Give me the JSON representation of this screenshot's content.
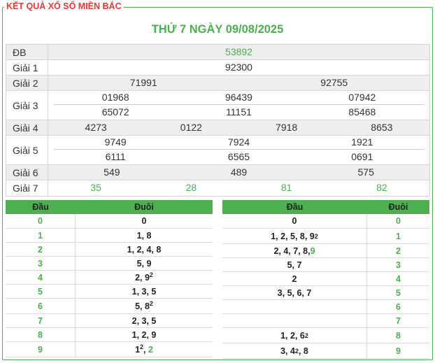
{
  "header": {
    "legend": "KẾT QUẢ XỔ SỐ MIỀN BẮC",
    "date_title": "THỨ 7 NGÀY 09/08/2025"
  },
  "results": {
    "db": {
      "label": "ĐB",
      "values": [
        "53892"
      ]
    },
    "g1": {
      "label": "Giải 1",
      "values": [
        "92300"
      ]
    },
    "g2": {
      "label": "Giải 2",
      "values": [
        "71991",
        "92755"
      ]
    },
    "g3": {
      "label": "Giải 3",
      "values": [
        "01968",
        "96439",
        "07942",
        "65072",
        "11151",
        "85468"
      ]
    },
    "g4": {
      "label": "Giải 4",
      "values": [
        "4273",
        "0122",
        "7918",
        "8653"
      ]
    },
    "g5": {
      "label": "Giải 5",
      "values": [
        "9749",
        "7924",
        "1921",
        "6111",
        "6565",
        "0691"
      ]
    },
    "g6": {
      "label": "Giải 6",
      "values": [
        "549",
        "489",
        "575"
      ]
    },
    "g7": {
      "label": "Giải 7",
      "values": [
        "35",
        "28",
        "81",
        "82"
      ]
    }
  },
  "dau_table": {
    "col_dau": "Đầu",
    "col_duoi": "Đuôi",
    "rows": [
      {
        "dau": "0",
        "duoi": "0"
      },
      {
        "dau": "1",
        "duoi": "1, 8"
      },
      {
        "dau": "2",
        "duoi": "1, 2, 4, 8"
      },
      {
        "dau": "3",
        "duoi": "5, 9"
      },
      {
        "dau": "4",
        "duoi": "2, 9",
        "sup": "2"
      },
      {
        "dau": "5",
        "duoi": "1, 3, 5"
      },
      {
        "dau": "6",
        "duoi": "5, 8",
        "sup": "2"
      },
      {
        "dau": "7",
        "duoi": "2, 3, 5"
      },
      {
        "dau": "8",
        "duoi": "1, 2, 9"
      },
      {
        "dau": "9",
        "duoi_pre": "1",
        "sup": "2",
        "duoi_post": ", ",
        "duoi_green": "2"
      }
    ]
  },
  "duoi_table": {
    "col_dau": "Đầu",
    "col_duoi": "Đuôi",
    "rows": [
      {
        "dau": "0",
        "duoi": "0"
      },
      {
        "dau": "1, 2, 5, 8, 9",
        "sup": "2",
        "duoi": "1"
      },
      {
        "dau_pre": "2, 4, 7, 8, ",
        "dau_green": "9",
        "duoi": "2"
      },
      {
        "dau": "5, 7",
        "duoi": "3"
      },
      {
        "dau": "2",
        "duoi": "4"
      },
      {
        "dau": "3, 5, 6, 7",
        "duoi": "5"
      },
      {
        "dau": "",
        "duoi": "6"
      },
      {
        "dau": "",
        "duoi": "7"
      },
      {
        "dau": "1, 2, 6",
        "sup": "2",
        "duoi": "8"
      },
      {
        "dau_pre": "3, 4",
        "sup": "2",
        "dau_post": ", 8",
        "duoi": "9"
      }
    ]
  }
}
